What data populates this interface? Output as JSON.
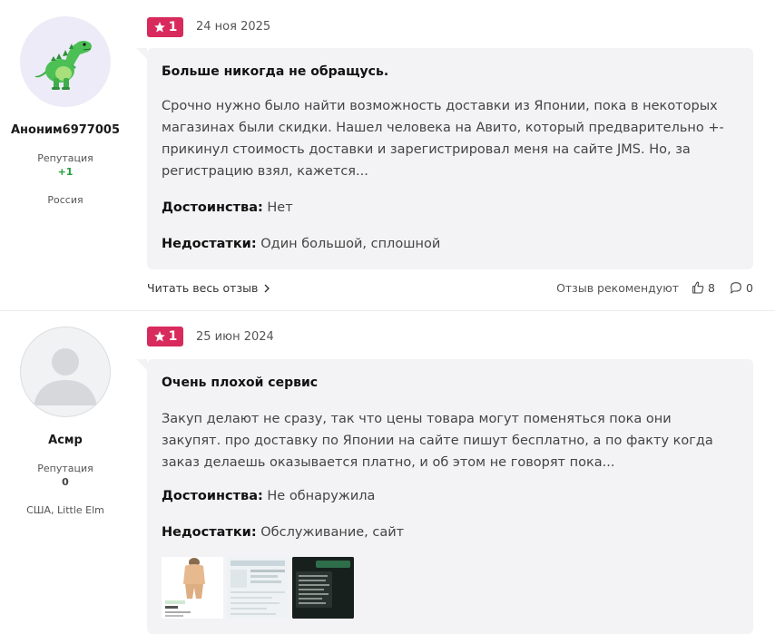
{
  "reviews": [
    {
      "author": "Аноним6977005",
      "reputation_label": "Репутация",
      "reputation_value": "+1",
      "location": "Россия",
      "rating": "1",
      "date": "24 ноя 2025",
      "title": "Больше никогда не обращусь.",
      "text": "Срочно нужно было найти возможность доставки из Японии, пока в некоторых магазинах были скидки. Нашел человека на Авито, который предварительно +- прикинул стоимость доставки и зарегистрировал меня на сайте JMS. Но, за регистрацию взял, кажется...",
      "pros_label": "Достоинства:",
      "pros": "Нет",
      "cons_label": "Недостатки:",
      "cons": "Один большой, сплошной",
      "read_more": "Читать весь отзыв",
      "recommend_label": "Отзыв рекомендуют",
      "likes": "8",
      "comments": "0"
    },
    {
      "author": "Асмр",
      "reputation_label": "Репутация",
      "reputation_value": "0",
      "location": "США, Little Elm",
      "rating": "1",
      "date": "25 июн 2024",
      "title": "Очень плохой сервис",
      "text": "Закуп делают не сразу, так что цены товара могут поменяться пока они закупят. про доставку по Японии на сайте пишут бесплатно, а по факту когда заказ делаешь оказывается платно, и об этом не говорят пока...",
      "pros_label": "Достоинства:",
      "pros": "Не обнаружила",
      "cons_label": "Недостатки:",
      "cons": "Обслуживание, сайт"
    }
  ],
  "icons": {
    "rating_star": "star-icon",
    "read_more_chevron": "chevron-right-icon",
    "like": "thumbs-up-icon",
    "comment": "comment-bubble-icon",
    "avatar_1": "dinosaur-avatar-icon",
    "avatar_2": "default-user-avatar-icon"
  },
  "colors": {
    "rating_badge": "#d82a5c",
    "reputation_positive": "#1f9e3a",
    "bubble_bg": "#f3f3f5"
  }
}
